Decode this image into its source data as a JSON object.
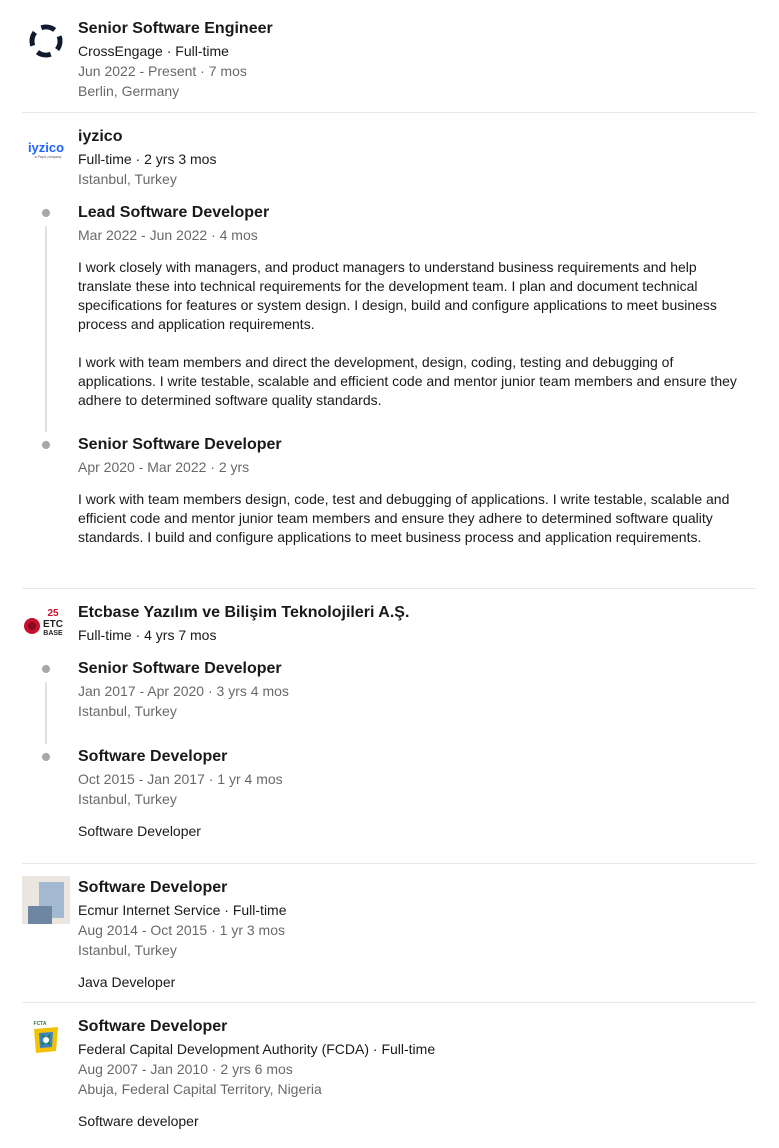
{
  "experience": {
    "crossengage": {
      "logo": "crossengage-logo-icon",
      "title": "Senior Software Engineer",
      "company_line": "CrossEngage · Full-time",
      "dates": "Jun 2022 - Present · 7 mos",
      "location": "Berlin, Germany"
    },
    "iyzico": {
      "logo": "iyzico-logo-icon",
      "logo_text": "iyzico",
      "logo_small": "a PayU company",
      "company": "iyzico",
      "tenure": "Full-time · 2 yrs 3 mos",
      "location": "Istanbul, Turkey",
      "roles": [
        {
          "title": "Lead Software Developer",
          "dates": "Mar 2022 - Jun 2022 · 4 mos",
          "description_1": "I work closely with managers, and product managers to understand business requirements and help translate these into technical requirements for the development team. I plan and document technical specifications for features or system design. I design, build and configure applications to meet business process and application requirements.",
          "description_2": "I work with team members and direct the development, design, coding, testing and debugging of applications. I write testable, scalable and efficient code and mentor junior team members and ensure they adhere to determined software quality standards."
        },
        {
          "title": "Senior Software Developer",
          "dates": "Apr 2020 - Mar 2022 · 2 yrs",
          "description_1": "I work with team members design, code, test and debugging of applications. I write testable, scalable and efficient code and mentor junior team members and ensure they adhere to determined software quality standards. I build and configure applications to meet business process and application requirements."
        }
      ]
    },
    "etcbase": {
      "logo": "etcbase-logo-icon",
      "logo_text_top": "25",
      "logo_text_mid": "ETC",
      "logo_text_bottom": "BASE",
      "company": "Etcbase Yazılım ve Bilişim Teknolojileri A.Ş.",
      "tenure": "Full-time · 4 yrs 7 mos",
      "roles": [
        {
          "title": "Senior Software Developer",
          "dates": "Jan 2017 - Apr 2020 · 3 yrs 4 mos",
          "location": "Istanbul, Turkey"
        },
        {
          "title": "Software Developer",
          "dates": "Oct 2015 - Jan 2017 · 1 yr 4 mos",
          "location": "Istanbul, Turkey",
          "description": "Software Developer"
        }
      ]
    },
    "ecmur": {
      "logo": "company-placeholder-icon",
      "title": "Software Developer",
      "company_line": "Ecmur Internet Service · Full-time",
      "dates": "Aug 2014 - Oct 2015 · 1 yr 3 mos",
      "location": "Istanbul, Turkey",
      "description": "Java Developer"
    },
    "fcda": {
      "logo": "fcda-logo-icon",
      "logo_text": "FCTA",
      "title": "Software Developer",
      "company_line": "Federal Capital Development Authority (FCDA) · Full-time",
      "dates": "Aug 2007 - Jan 2010 · 2 yrs 6 mos",
      "location": "Abuja, Federal Capital Territory, Nigeria",
      "description": "Software developer"
    }
  },
  "colors": {
    "text_primary": "#1a1a1a",
    "text_secondary": "#666666",
    "divider": "#e8e8e8",
    "timeline_dot": "#a8a8a8",
    "iyzico_blue": "#1e64ff",
    "etcbase_red": "#c8102e"
  }
}
